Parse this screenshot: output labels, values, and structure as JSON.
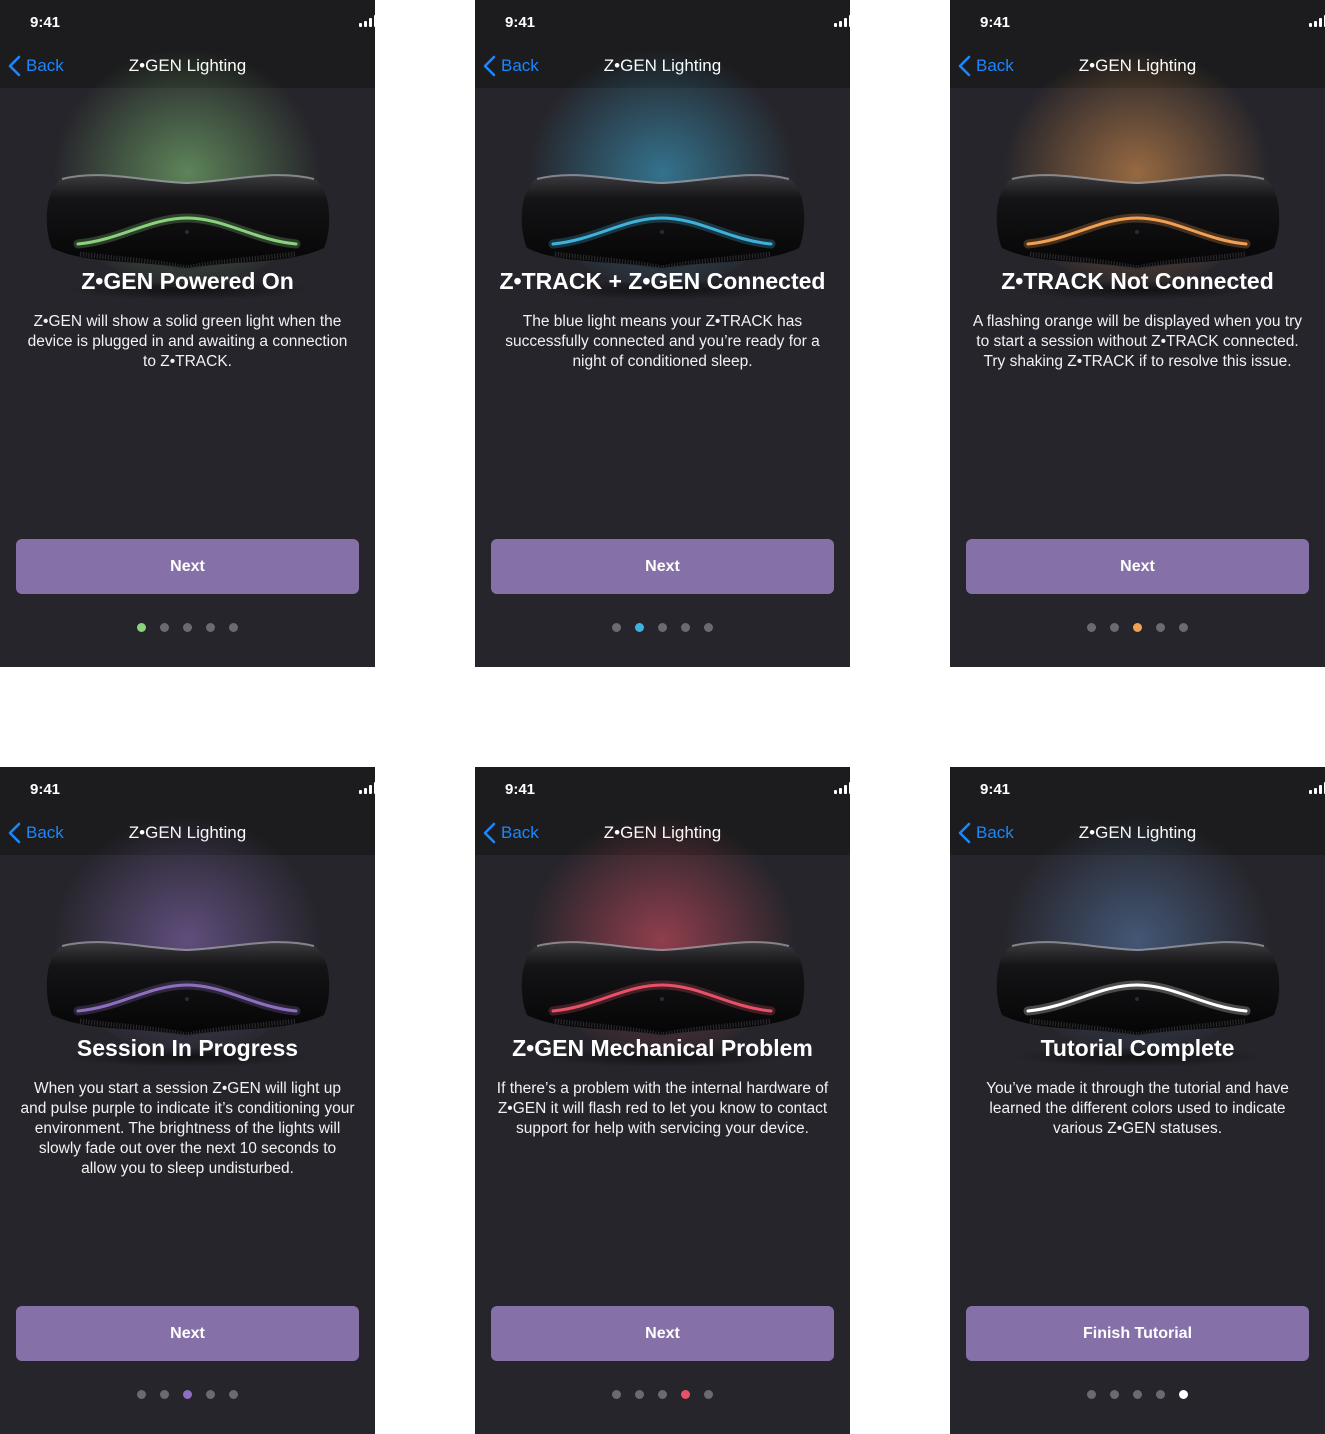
{
  "status": {
    "time": "9:41"
  },
  "nav": {
    "back_label": "Back",
    "title": "Z•GEN Lighting"
  },
  "screens": [
    {
      "heading": "Z•GEN Powered On",
      "body": "Z•GEN will show a solid green light when the device is plugged in and awaiting a connection to  Z•TRACK.",
      "button": "Next",
      "light_color": "#8bd27f",
      "active_page": 0
    },
    {
      "heading": "Z•TRACK + Z•GEN Connected",
      "body": "The blue light means your Z•TRACK has successfully connected and you’re ready for a night of conditioned sleep.",
      "button": "Next",
      "light_color": "#3fb2dc",
      "active_page": 1
    },
    {
      "heading": "Z•TRACK Not Connected",
      "body": "A flashing orange will be displayed when you try to start a session without Z•TRACK connected. Try shaking Z•TRACK if to resolve this issue.",
      "button": "Next",
      "light_color": "#f2a154",
      "active_page": 2
    },
    {
      "heading": "Session In Progress",
      "body": "When you start a session Z•GEN will light up and pulse purple to indicate it’s conditioning your environment. The brightness of the lights will slowly fade out over the next 10 seconds to allow you to sleep undisturbed.",
      "button": "Next",
      "light_color": "#8e6fbf",
      "active_page": 2
    },
    {
      "heading": "Z•GEN Mechanical Problem",
      "body": "If there’s a problem with the internal hardware of Z•GEN it will flash red to let you know to contact support for help with servicing your device.",
      "button": "Next",
      "light_color": "#e65268",
      "active_page": 3
    },
    {
      "heading": "Tutorial Complete",
      "body": "You’ve made it through the tutorial and have learned the different colors used to indicate various Z•GEN statuses.",
      "button": "Finish Tutorial",
      "light_color": "#ffffff",
      "glow_color": "#5b7fb2",
      "active_page": 4
    }
  ]
}
